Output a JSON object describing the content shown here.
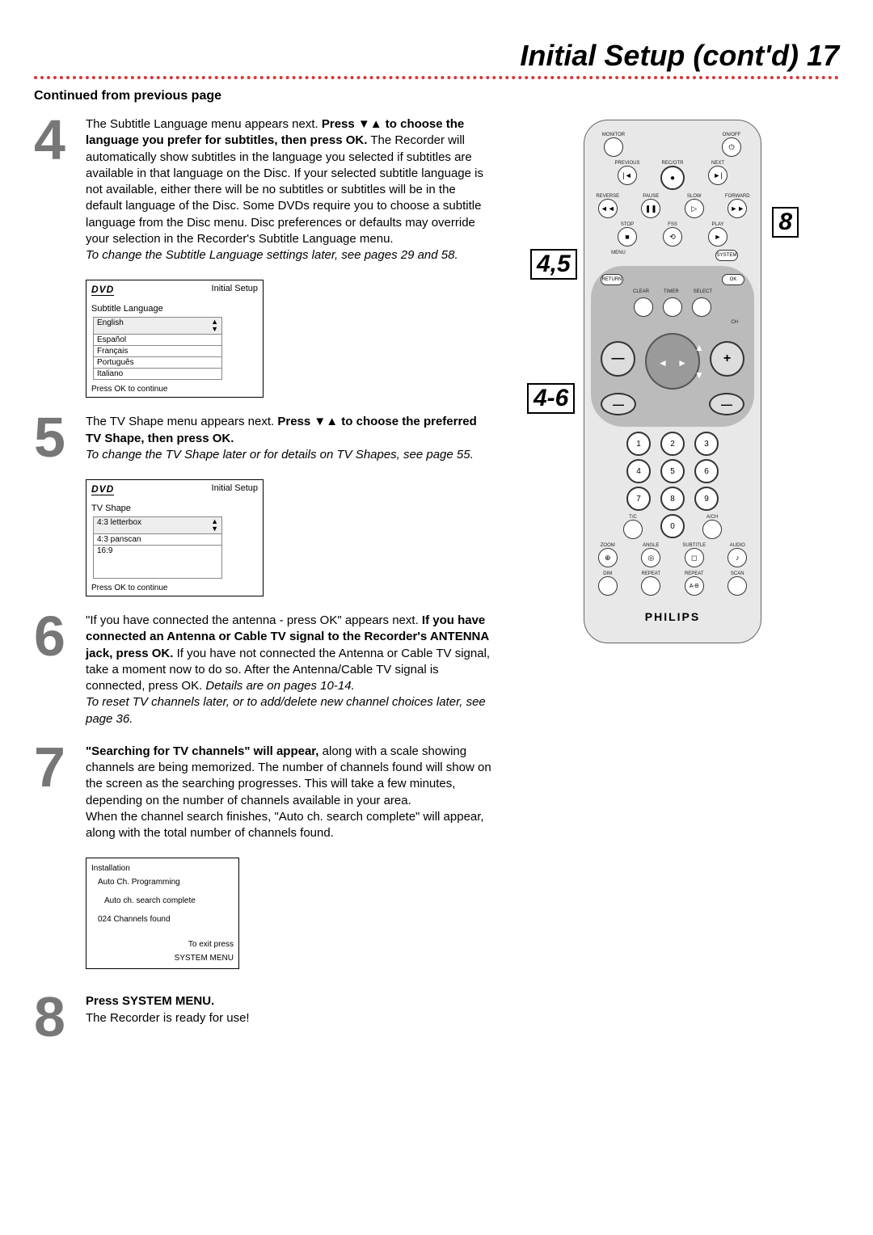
{
  "header": {
    "title": "Initial Setup (cont'd)",
    "page_number": "17",
    "continued_label": "Continued from previous page"
  },
  "steps": {
    "s4": {
      "num": "4",
      "lead": "The Subtitle Language menu appears next. ",
      "bold": "Press ▼▲ to choose the language you prefer for subtitles, then press OK.",
      "rest": " The Recorder will automatically show subtitles in the language you selected if subtitles are available in that language on the Disc. If your selected subtitle language is not available, either there will be no subtitles or subtitles will be in the default language of the Disc. Some DVDs require you to choose a subtitle language from the Disc menu. Disc preferences or defaults may override your selection in the Recorder's Subtitle Language menu.",
      "note": "To change the Subtitle Language settings later, see pages 29 and 58."
    },
    "s5": {
      "num": "5",
      "lead": "The TV Shape menu appears next. ",
      "bold": "Press ▼▲ to choose the preferred TV Shape, then press OK.",
      "note": "To change the TV Shape later or for details on TV Shapes, see page 55."
    },
    "s6": {
      "num": "6",
      "lead": "\"If you have connected the antenna - press OK\" appears next. ",
      "bold": "If you have connected an Antenna or Cable TV signal to the Recorder's ANTENNA jack, press OK.",
      "rest": " If you have not connected the Antenna or Cable TV signal, take a moment now to do so. After the Antenna/Cable TV signal is connected, press OK. ",
      "details": "Details are on pages 10-14.",
      "note": "To reset TV channels later, or to add/delete new channel choices later, see page 36."
    },
    "s7": {
      "num": "7",
      "bold": "\"Searching for TV channels\" will appear, ",
      "rest": "along with a scale showing channels are being memorized. The number of channels found will show on the screen as the searching progresses. This will take a few minutes, depending on the number of channels available in your area.",
      "rest2": "When the channel search finishes, \"Auto ch. search complete\" will appear, along with the total number of channels found."
    },
    "s8": {
      "num": "8",
      "bold": "Press SYSTEM MENU.",
      "rest": " The Recorder is ready for use!"
    }
  },
  "osd_subtitle": {
    "brand": "DVD",
    "title": "Initial Setup",
    "group_label": "Subtitle Language",
    "options": [
      "English",
      "Español",
      "Français",
      "Português",
      "Italiano"
    ],
    "foot": "Press OK to continue"
  },
  "osd_tvshape": {
    "brand": "DVD",
    "title": "Initial Setup",
    "group_label": "TV Shape",
    "options": [
      "4:3 letterbox",
      "4:3 panscan",
      "16:9"
    ],
    "foot": "Press OK to continue"
  },
  "osd_install": {
    "title": "Installation",
    "sub": "Auto Ch. Programming",
    "line1": "Auto ch. search complete",
    "line2": "024 Channels found",
    "exit1": "To exit press",
    "exit2": "SYSTEM MENU"
  },
  "remote": {
    "top_row": [
      {
        "label": "MONITOR",
        "glyph": ""
      },
      {
        "label": "ON/OFF",
        "glyph": "⏻"
      }
    ],
    "row2": [
      {
        "label": "PREVIOUS",
        "glyph": "|◄"
      },
      {
        "label": "REC/OTR",
        "glyph": "●"
      },
      {
        "label": "NEXT",
        "glyph": "►|"
      }
    ],
    "row3": [
      {
        "label": "REVERSE",
        "glyph": "◄◄"
      },
      {
        "label": "PAUSE",
        "glyph": "❚❚"
      },
      {
        "label": "SLOW",
        "glyph": "▷"
      },
      {
        "label": "FORWARD",
        "glyph": "►►"
      }
    ],
    "row4": [
      {
        "label": "STOP",
        "glyph": "■"
      },
      {
        "label": "FSS",
        "glyph": "⟲"
      },
      {
        "label": "PLAY",
        "glyph": "►"
      }
    ],
    "row4b": [
      {
        "label": "MENU",
        "glyph": ""
      },
      {
        "label": "SYSTEM",
        "glyph": ""
      }
    ],
    "dpad": {
      "return_label": "RETURN",
      "ok_label": "OK",
      "top_labels": [
        "CLEAR",
        "TIMER",
        "SELECT"
      ],
      "ch_label": "CH"
    },
    "keypad": [
      "1",
      "2",
      "3",
      "4",
      "5",
      "6",
      "7",
      "8",
      "9",
      "0"
    ],
    "keypad_side": {
      "left": "T/C",
      "right": "A/CH"
    },
    "bottom_row1": [
      {
        "label": "ZOOM",
        "glyph": "⊕"
      },
      {
        "label": "ANGLE",
        "glyph": "◎"
      },
      {
        "label": "SUBTITLE",
        "glyph": "◻"
      },
      {
        "label": "AUDIO",
        "glyph": "♪"
      }
    ],
    "bottom_row2": [
      {
        "label": "DIM",
        "glyph": ""
      },
      {
        "label": "REPEAT",
        "glyph": ""
      },
      {
        "label": "REPEAT",
        "glyph": "A-B"
      },
      {
        "label": "SCAN",
        "glyph": ""
      }
    ],
    "brand": "PHILIPS",
    "callouts": {
      "c8": "8",
      "c45": "4,5",
      "c46": "4-6"
    }
  }
}
